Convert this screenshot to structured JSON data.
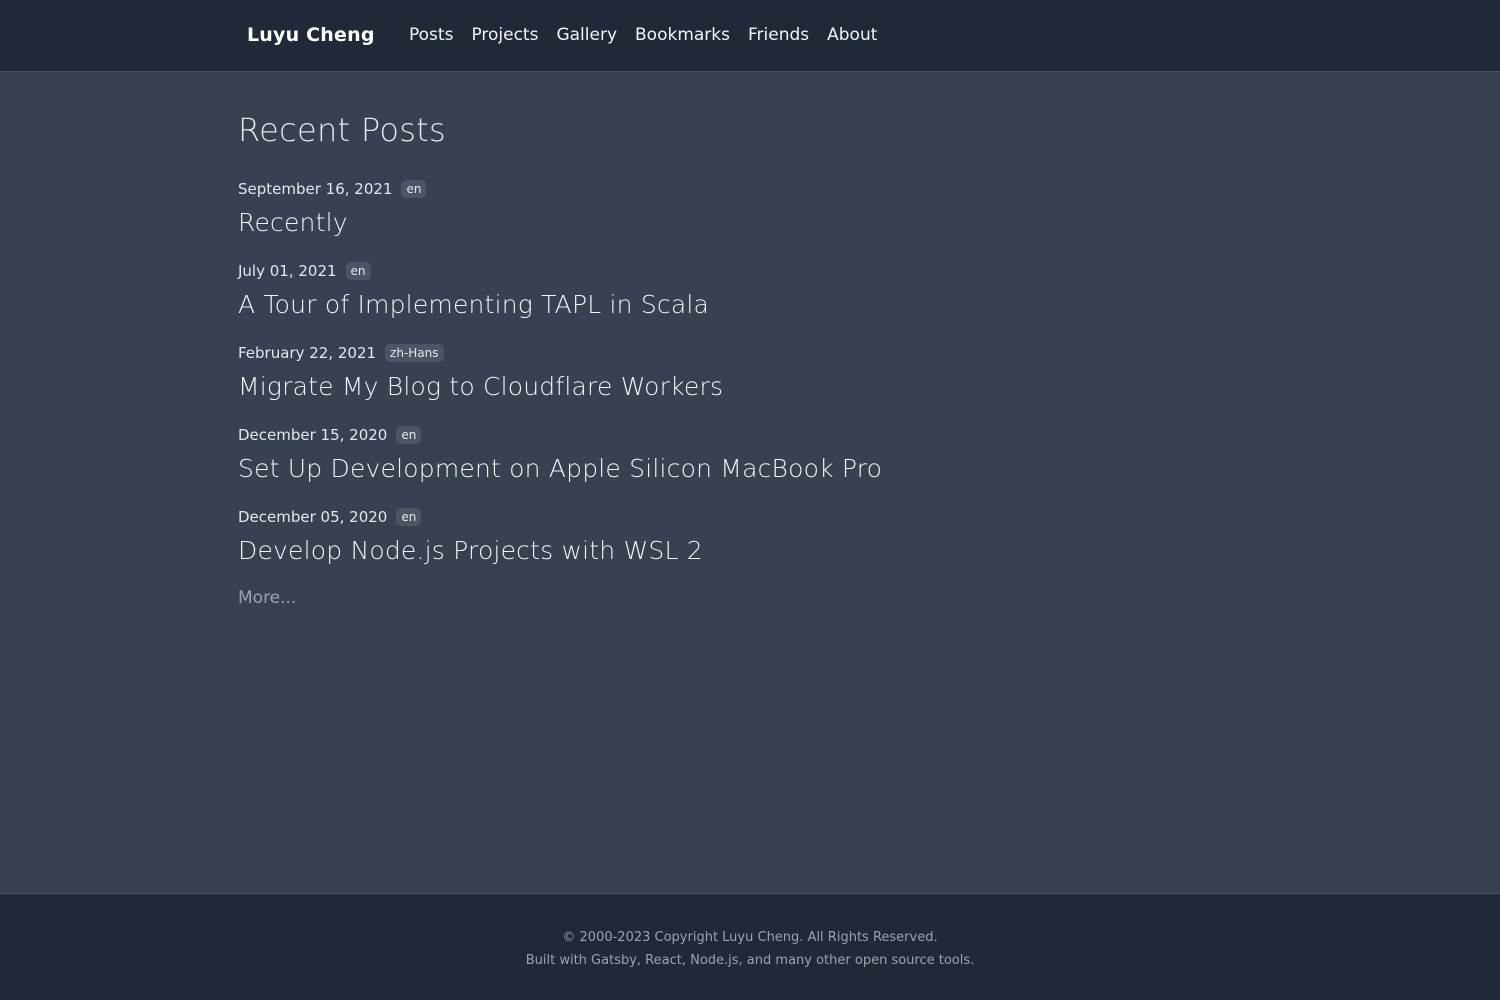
{
  "header": {
    "brand": "Luyu Cheng",
    "nav": [
      "Posts",
      "Projects",
      "Gallery",
      "Bookmarks",
      "Friends",
      "About"
    ]
  },
  "main": {
    "title": "Recent Posts",
    "posts": [
      {
        "date": "September 16, 2021",
        "lang": "en",
        "title": "Recently"
      },
      {
        "date": "July 01, 2021",
        "lang": "en",
        "title": "A Tour of Implementing TAPL in Scala"
      },
      {
        "date": "February 22, 2021",
        "lang": "zh-Hans",
        "title": "Migrate My Blog to Cloudflare Workers"
      },
      {
        "date": "December 15, 2020",
        "lang": "en",
        "title": "Set Up Development on Apple Silicon MacBook Pro"
      },
      {
        "date": "December 05, 2020",
        "lang": "en",
        "title": "Develop Node.js Projects with WSL 2"
      }
    ],
    "more": "More..."
  },
  "footer": {
    "copyright": "© 2000-2023 Copyright Luyu Cheng. All Rights Reserved.",
    "built_with": "Built with Gatsby, React, Node.js, and many other open source tools."
  },
  "colors": {
    "background": "#374151",
    "header_bg": "#1f2937",
    "tag_bg": "#4b5563"
  }
}
